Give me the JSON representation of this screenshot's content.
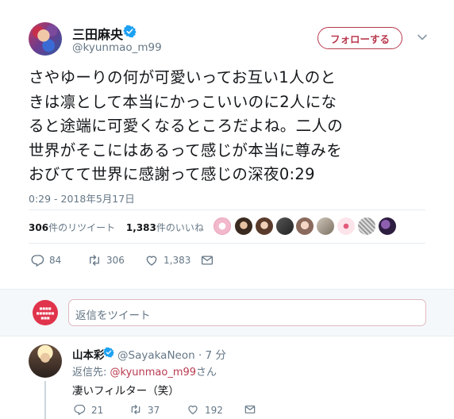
{
  "tweet": {
    "display_name": "三田麻央",
    "screen_name": "@kyunmao_m99",
    "follow_label": "フォローする",
    "text_lines": [
      "さやゆーりの何が可愛いってお互い1人のと",
      "きは凛として本当にかっこいいのに2人にな",
      "ると途端に可愛くなるところだよね。二人の",
      "世界がそこにはあるって感じが本当に尊みを",
      "おびてて世界に感謝って感じの深夜0:29"
    ],
    "timestamp": "0:29 - 2018年5月17日",
    "retweets_count": "306",
    "retweets_label": "件のリツイート",
    "likes_count": "1,383",
    "likes_label": "件のいいね",
    "actions": {
      "reply_count": "84",
      "retweet_count": "306",
      "like_count": "1,383"
    }
  },
  "reply_box": {
    "placeholder": "返信をツイート"
  },
  "reply": {
    "display_name": "山本彩",
    "handle_time": "@SayakaNeon · 7 分",
    "reply_to_prefix": "返信先: ",
    "reply_to_mention": "@kyunmao_m99",
    "reply_to_suffix": "さん",
    "text": "凄いフィルター（笑）",
    "reply_count": "21",
    "retweet_count": "37",
    "like_count": "192"
  },
  "colors": {
    "accent": "#b93a4f",
    "verified": "#1da1f2",
    "muted": "#657786"
  }
}
